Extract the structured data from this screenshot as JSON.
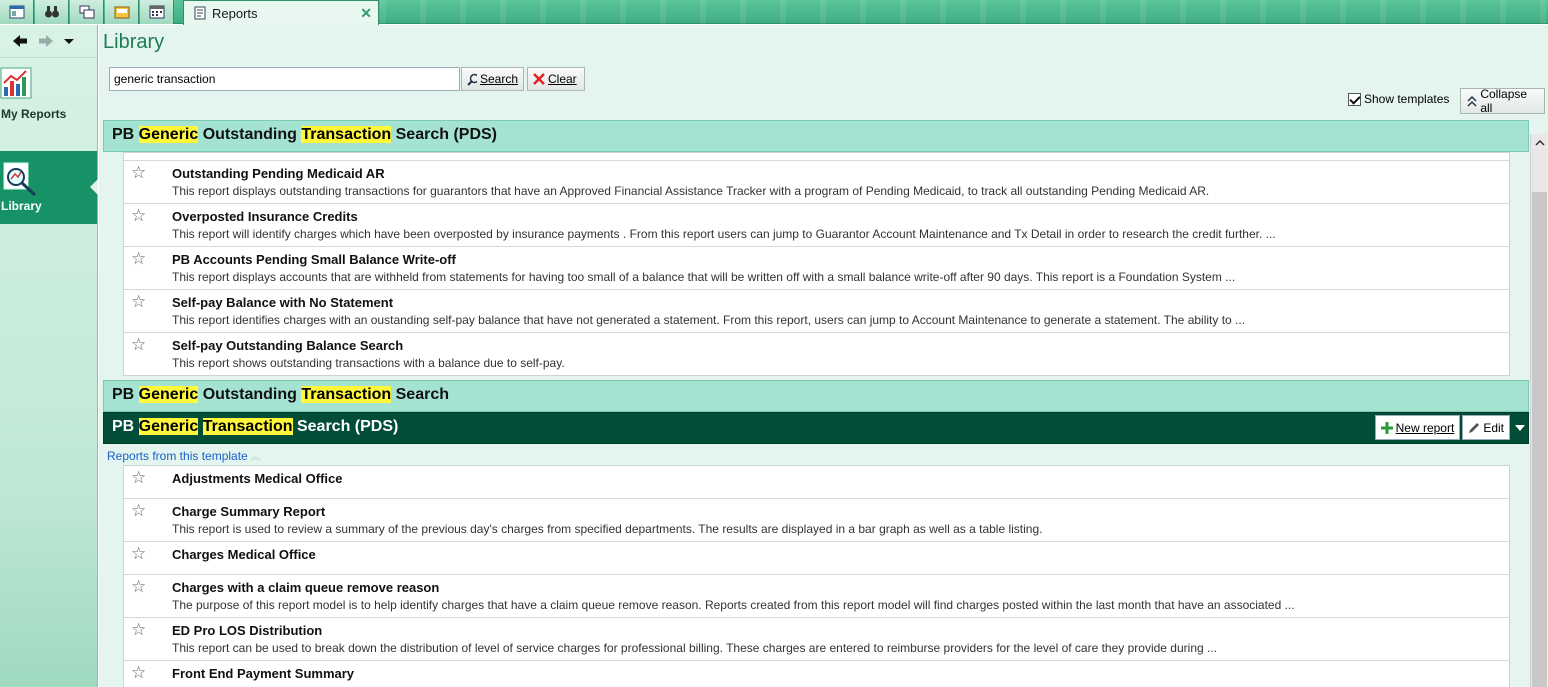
{
  "toolbar": {
    "icons": [
      "workspace-icon",
      "binoculars-icon",
      "windows-icon",
      "inbox-icon",
      "calendar-icon"
    ],
    "active_tab": "Reports",
    "close_glyph": "✕"
  },
  "nav": {
    "my_reports": "My Reports",
    "library": "Library"
  },
  "page": {
    "title": "Library",
    "search_value": "generic transaction",
    "search_button": "Search",
    "clear_button": "Clear",
    "show_templates": "Show templates",
    "collapse_all": "Collapse all"
  },
  "group1": {
    "title_parts": [
      "PB ",
      "Generic",
      " Outstanding ",
      "Transaction",
      " Search (PDS)"
    ],
    "items": [
      {
        "title": "Outstanding Pending Medicaid AR",
        "desc": "This report displays outstanding transactions for guarantors that have an Approved Financial Assistance Tracker with a program of Pending Medicaid, to track all outstanding Pending Medicaid AR."
      },
      {
        "title": "Overposted Insurance Credits",
        "desc": "This report will identify charges which have been overposted by insurance payments . From this report users can jump to Guarantor Account Maintenance and Tx Detail in order to research the credit further. ..."
      },
      {
        "title": "PB Accounts Pending Small Balance Write-off",
        "desc": "This report displays accounts that are withheld from statements for having too small of a balance that will be written off with a small balance write-off after 90 days. This report is a Foundation System ..."
      },
      {
        "title": "Self-pay Balance with No Statement",
        "desc": "This report identifies charges with an oustanding self-pay balance that have not generated a statement. From this report, users can jump to Account Maintenance to generate a statement. The ability to ..."
      },
      {
        "title": "Self-pay Outstanding Balance Search",
        "desc": "This report shows outstanding transactions with a balance due to self-pay."
      }
    ]
  },
  "group2": {
    "title_parts": [
      "PB ",
      "Generic",
      " Outstanding ",
      "Transaction",
      " Search"
    ]
  },
  "group3": {
    "title_parts": [
      "PB ",
      "Generic",
      " ",
      "Transaction",
      " Search (PDS)"
    ],
    "new_report": "New report",
    "edit": "Edit",
    "templates_link": "Reports from this template",
    "items": [
      {
        "title": "Adjustments Medical Office",
        "desc": ""
      },
      {
        "title": "Charge Summary Report",
        "desc": "This report is used to review a summary of the previous day's charges from specified departments. The results are displayed in a bar graph as well as a table listing."
      },
      {
        "title": "Charges Medical Office",
        "desc": ""
      },
      {
        "title": "Charges with a claim queue remove reason",
        "desc": "The purpose of this report model is to help identify charges that have a claim queue remove reason. Reports created from this report model will find charges posted within the last month that have an associated ..."
      },
      {
        "title": "ED Pro LOS Distribution",
        "desc": "This report can be used to break down the distribution of level of service charges for professional billing. These charges are entered to reimburse providers for the level of care they provide during ..."
      },
      {
        "title": "Front End Payment Summary",
        "desc": ""
      }
    ]
  },
  "colors": {
    "accent": "#179266",
    "selected_header": "#014d38",
    "header": "#a4e3d2",
    "highlight": "#fff73a"
  }
}
